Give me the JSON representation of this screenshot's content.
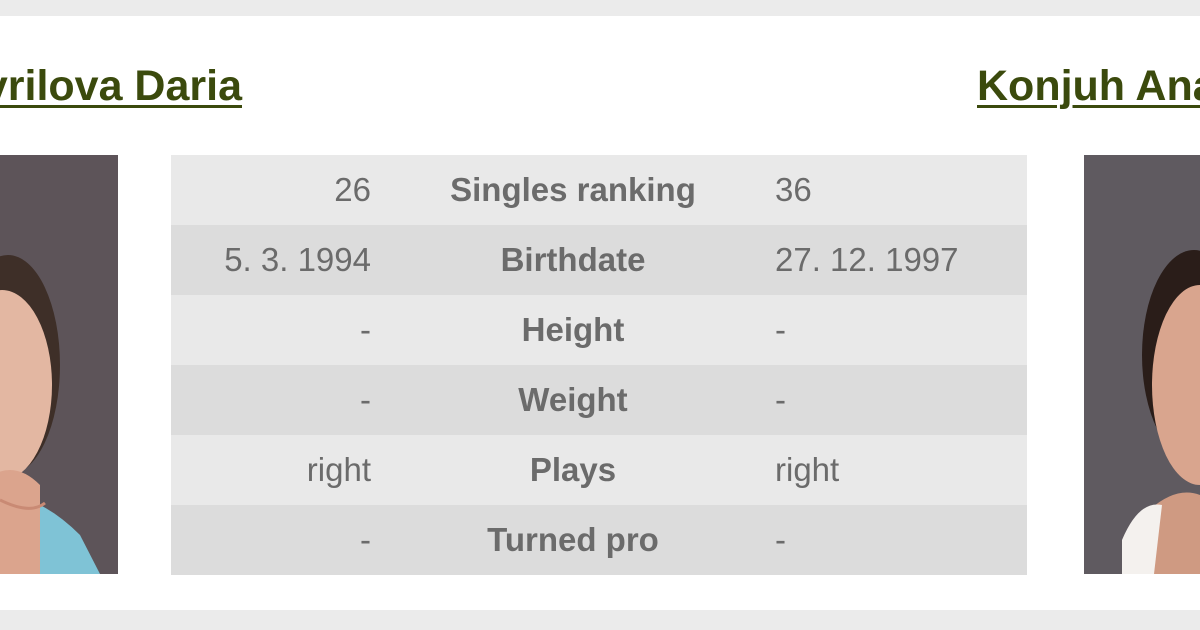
{
  "players": {
    "left": {
      "name": "Gavrilova Daria"
    },
    "right": {
      "name": "Konjuh Ana"
    }
  },
  "comparison": {
    "rows": [
      {
        "left": "26",
        "label": "Singles ranking",
        "right": "36"
      },
      {
        "left": "5. 3. 1994",
        "label": "Birthdate",
        "right": "27. 12. 1997"
      },
      {
        "left": "-",
        "label": "Height",
        "right": "-"
      },
      {
        "left": "-",
        "label": "Weight",
        "right": "-"
      },
      {
        "left": "right",
        "label": "Plays",
        "right": "right"
      },
      {
        "left": "-",
        "label": "Turned pro",
        "right": "-"
      }
    ]
  },
  "colors": {
    "name_link": "#3b4a0d",
    "row_light": "#e9e9e9",
    "row_dark": "#dcdcdc",
    "text_gray": "#6b6b6b",
    "page_bg": "#ebebeb"
  }
}
